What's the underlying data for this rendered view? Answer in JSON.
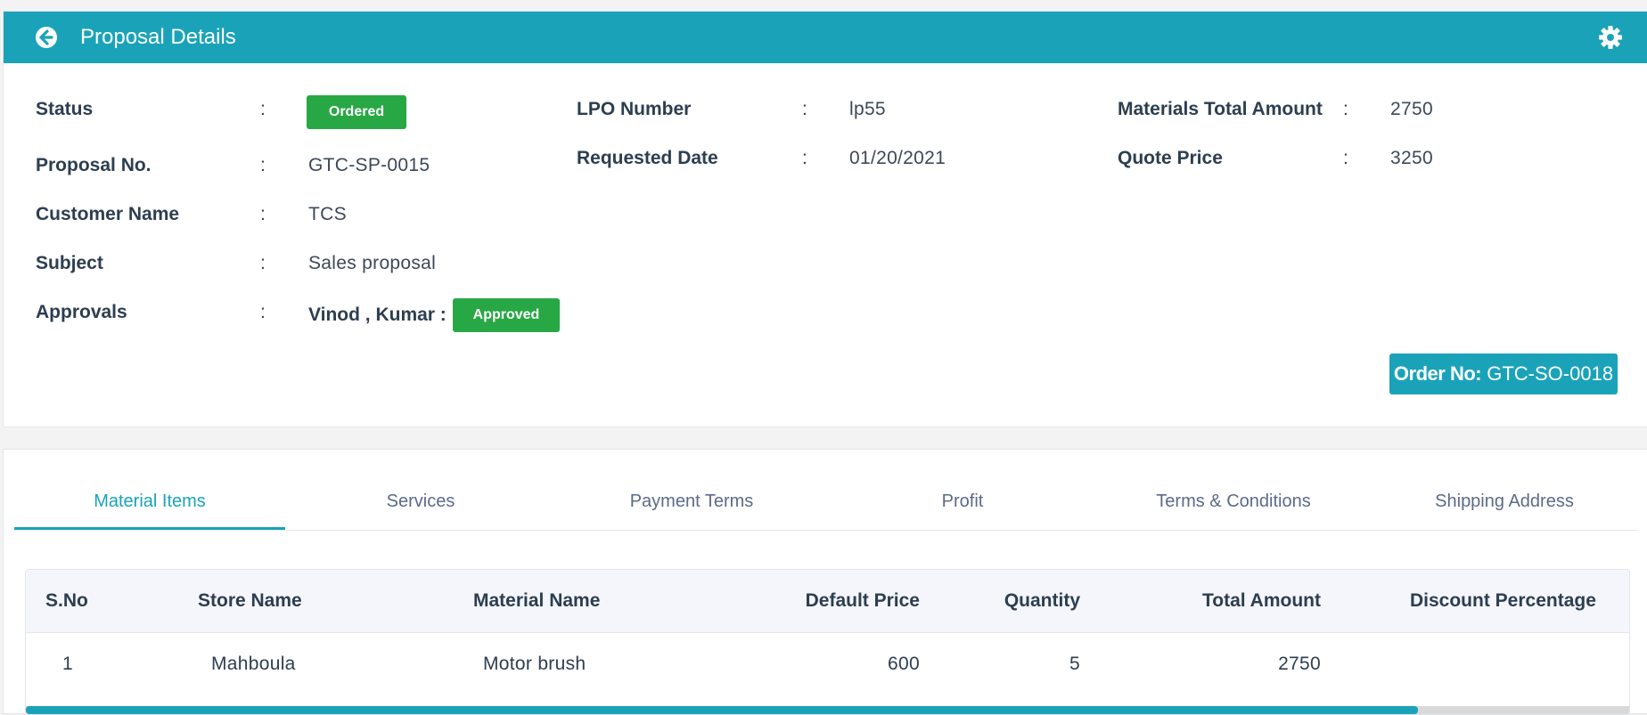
{
  "header": {
    "title": "Proposal Details"
  },
  "details": {
    "status_label": "Status",
    "status_value": "Ordered",
    "proposal_no_label": "Proposal No.",
    "proposal_no_value": "GTC-SP-0015",
    "customer_name_label": "Customer Name",
    "customer_name_value": "TCS",
    "subject_label": "Subject",
    "subject_value": "Sales proposal",
    "approvals_label": "Approvals",
    "approvals_names": "Vinod , Kumar :",
    "approvals_status": "Approved",
    "lpo_number_label": "LPO Number",
    "lpo_number_value": "lp55",
    "requested_date_label": "Requested Date",
    "requested_date_value": "01/20/2021",
    "materials_total_label": "Materials Total Amount",
    "materials_total_value": "2750",
    "quote_price_label": "Quote Price",
    "quote_price_value": "3250",
    "colon": ":"
  },
  "order": {
    "label": "Order No:",
    "value": "GTC-SO-0018"
  },
  "tabs": [
    {
      "label": "Material Items",
      "active": true
    },
    {
      "label": "Services",
      "active": false
    },
    {
      "label": "Payment Terms",
      "active": false
    },
    {
      "label": "Profit",
      "active": false
    },
    {
      "label": "Terms & Conditions",
      "active": false
    },
    {
      "label": "Shipping Address",
      "active": false
    }
  ],
  "table": {
    "columns": [
      "S.No",
      "Store Name",
      "Material Name",
      "Default Price",
      "Quantity",
      "Total Amount",
      "Discount Percentage"
    ],
    "rows": [
      [
        "1",
        "Mahboula",
        "Motor brush",
        "600",
        "5",
        "2750",
        ""
      ]
    ]
  },
  "colors": {
    "primary": "#1aa3b8",
    "success": "#28a745"
  },
  "icons": {
    "back": "arrow-left-circle-icon",
    "settings": "gear-icon"
  }
}
